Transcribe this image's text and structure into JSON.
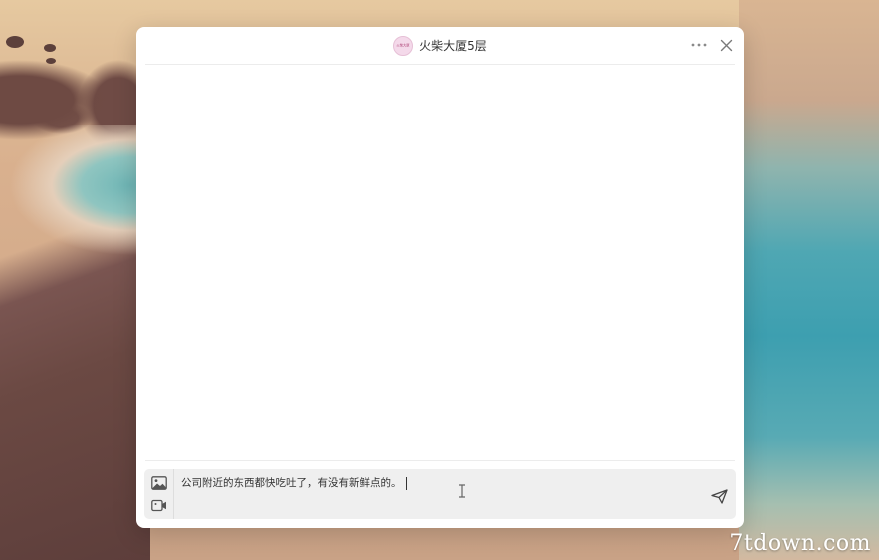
{
  "window": {
    "title": "火柴大厦5层",
    "avatar_text": "火柴大厦"
  },
  "composer": {
    "input_value": "公司附近的东西都快吃吐了，有没有新鲜点的。"
  },
  "icons": {
    "more": "more-icon",
    "close": "close-icon",
    "image": "image-icon",
    "video": "video-icon",
    "send": "send-icon"
  },
  "watermark": {
    "text": "7tdown.com"
  }
}
